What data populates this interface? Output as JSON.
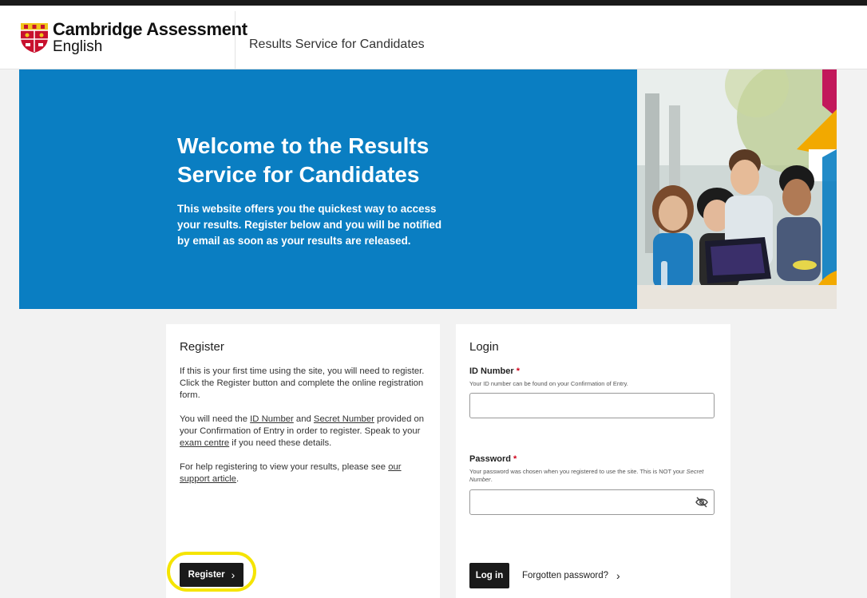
{
  "header": {
    "logo_line1": "Cambridge Assessment",
    "logo_line2": "English",
    "service_title": "Results Service for Candidates"
  },
  "hero": {
    "title": "Welcome to the Results Service for Candidates",
    "text": "This website offers you the quickest way to access your results. Register below and you will be notified by email as soon as your results are released.",
    "background_color": "#0a7ec2"
  },
  "register": {
    "title": "Register",
    "p1": "If this is your first time using the site, you will need to register. Click the Register button and complete the online registration form.",
    "p2_a": "You will need the ",
    "p2_link1": "ID Number",
    "p2_b": " and ",
    "p2_link2": "Secret Number",
    "p2_c": " provided on your Confirmation of Entry in order to register. Speak to your ",
    "p2_link3": "exam centre",
    "p2_d": " if you need these details.",
    "p3_a": "For help registering to view your results, please see ",
    "p3_link": "our support article",
    "p3_b": ".",
    "button_label": "Register",
    "highlight_color": "#f5e400"
  },
  "login": {
    "title": "Login",
    "id_label": "ID Number",
    "required_mark": "*",
    "id_hint": "Your ID number can be found on your Confirmation of Entry.",
    "id_value": "",
    "password_label": "Password",
    "password_hint_a": "Your password was chosen when you registered to use the site. This is NOT your ",
    "password_hint_em": "Secret Number",
    "password_hint_b": ".",
    "password_value": "",
    "button_label": "Log in",
    "forgot_label": "Forgotten password?"
  },
  "icons": {
    "chevron": "chevron-right-icon",
    "eye": "eye-slash-icon",
    "shield": "cambridge-shield-icon"
  }
}
